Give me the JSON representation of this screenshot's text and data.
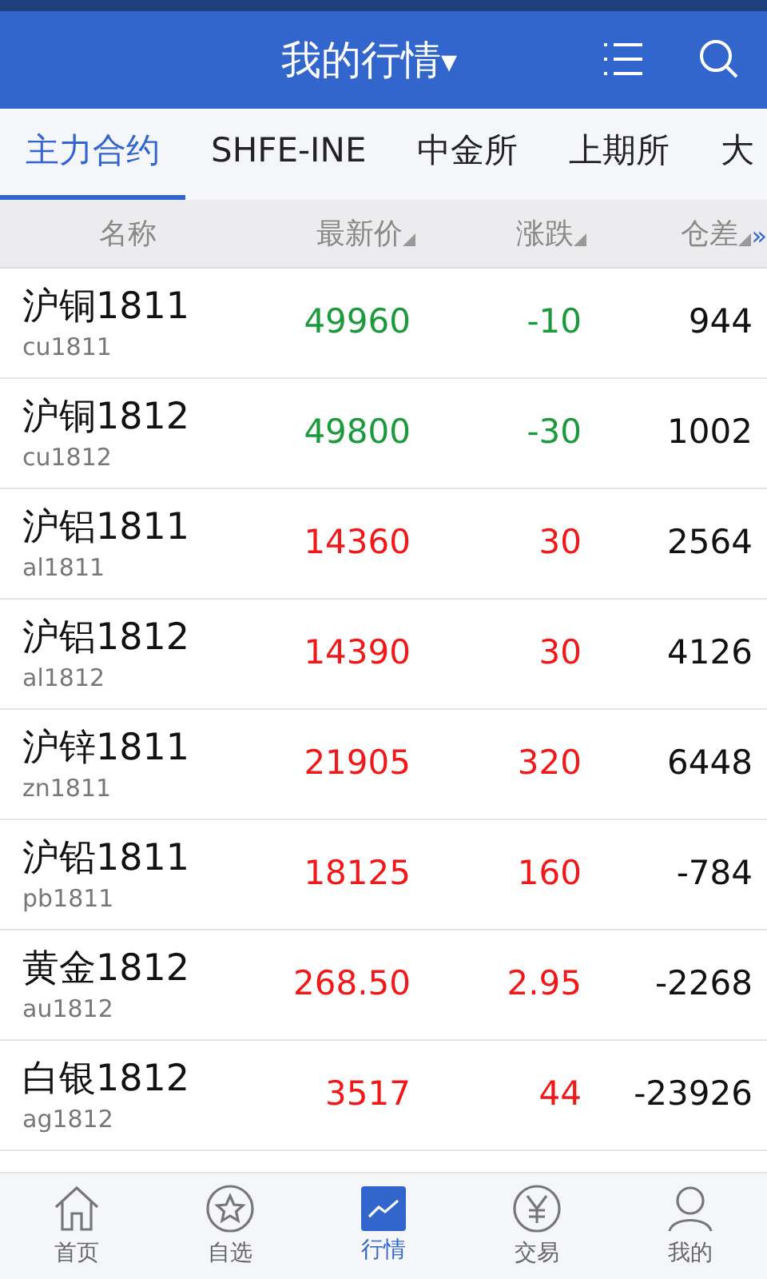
{
  "header": {
    "title": "我的行情",
    "caret": "▾"
  },
  "tabs": [
    {
      "label": "主力合约",
      "selected": true
    },
    {
      "label": "SHFE-INE",
      "selected": false
    },
    {
      "label": "中金所",
      "selected": false
    },
    {
      "label": "上期所",
      "selected": false
    },
    {
      "label": "大",
      "selected": false
    }
  ],
  "columns": [
    {
      "label": "名称",
      "sortable": false
    },
    {
      "label": "最新价",
      "sortable": true
    },
    {
      "label": "涨跌",
      "sortable": true
    },
    {
      "label": "仓差",
      "sortable": true,
      "more": "»"
    }
  ],
  "rows": [
    {
      "name": "沪铜1811",
      "code": "cu1811",
      "price": "49960",
      "change": "-10",
      "diff": "944",
      "kind": "fall"
    },
    {
      "name": "沪铜1812",
      "code": "cu1812",
      "price": "49800",
      "change": "-30",
      "diff": "1002",
      "kind": "fall"
    },
    {
      "name": "沪铝1811",
      "code": "al1811",
      "price": "14360",
      "change": "30",
      "diff": "2564",
      "kind": "rise"
    },
    {
      "name": "沪铝1812",
      "code": "al1812",
      "price": "14390",
      "change": "30",
      "diff": "4126",
      "kind": "rise"
    },
    {
      "name": "沪锌1811",
      "code": "zn1811",
      "price": "21905",
      "change": "320",
      "diff": "6448",
      "kind": "rise"
    },
    {
      "name": "沪铅1811",
      "code": "pb1811",
      "price": "18125",
      "change": "160",
      "diff": "-784",
      "kind": "rise"
    },
    {
      "name": "黄金1812",
      "code": "au1812",
      "price": "268.50",
      "change": "2.95",
      "diff": "-2268",
      "kind": "rise"
    },
    {
      "name": "白银1812",
      "code": "ag1812",
      "price": "3517",
      "change": "44",
      "diff": "-23926",
      "kind": "rise"
    }
  ],
  "nav": [
    {
      "label": "首页",
      "kind": "home",
      "selected": false
    },
    {
      "label": "自选",
      "kind": "star",
      "selected": false
    },
    {
      "label": "行情",
      "kind": "chart",
      "selected": true
    },
    {
      "label": "交易",
      "kind": "yen",
      "selected": false
    },
    {
      "label": "我的",
      "kind": "user",
      "selected": false
    }
  ]
}
